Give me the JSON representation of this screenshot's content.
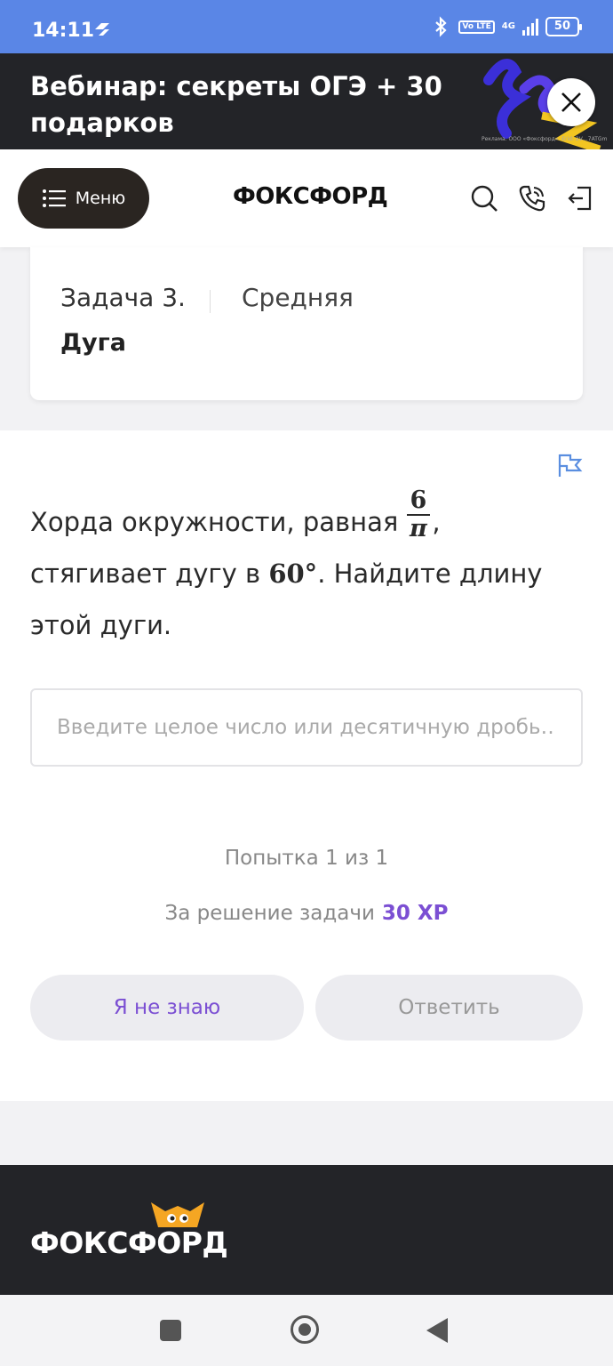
{
  "status_bar": {
    "time": "14:11",
    "volte": "Vo LTE",
    "network": "4G",
    "battery": "50"
  },
  "ad": {
    "title": "Вебинар: секреты ОГЭ + 30 подарков",
    "disclaimer": "Реклама. ООО «Фоксфорд». Erid: 2V…7ATGm"
  },
  "header": {
    "menu_label": "Меню",
    "logo": "ФОКСФОРД"
  },
  "task": {
    "number": "Задача 3.",
    "difficulty": "Средняя",
    "name": "Дуга"
  },
  "problem": {
    "text_before": "Хорда окружности, равная ",
    "frac_num": "6",
    "frac_den": "π",
    "text_middle": ", стягивает дугу в ",
    "degrees": "60°",
    "text_after": ". Найдите длину этой дуги."
  },
  "answer": {
    "placeholder": "Введите целое число или десятичную дробь…"
  },
  "attempt_text": "Попытка 1 из 1",
  "reward": {
    "label": "За решение задачи",
    "xp": "30 XP"
  },
  "buttons": {
    "dont_know": "Я не знаю",
    "submit": "Ответить"
  },
  "footer": {
    "logo": "ФОКСФОРД"
  },
  "colors": {
    "accent": "#7b4fd3",
    "status_bar": "#5a86e6",
    "dark": "#232428"
  }
}
